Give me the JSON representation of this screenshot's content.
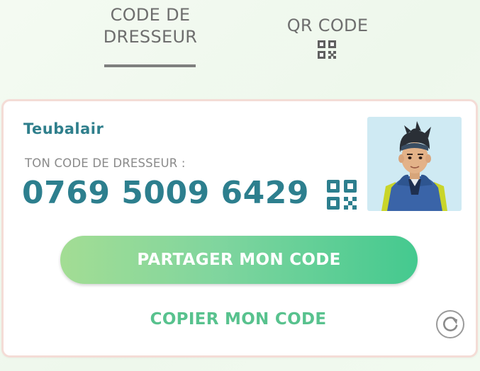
{
  "tabs": [
    {
      "label_line1": "CODE DE",
      "label_line2": "DRESSEUR",
      "active": true
    },
    {
      "label": "QR CODE",
      "icon": "qr-code-icon",
      "active": false
    }
  ],
  "card": {
    "username": "Teubalair",
    "code_label": "TON CODE DE DRESSEUR :",
    "code_value": "0769 5009 6429",
    "qr_icon": "qr-code-icon",
    "avatar_icon": "trainer-avatar",
    "share_label": "PARTAGER MON CODE",
    "copy_label": "COPIER MON CODE",
    "refresh_icon": "refresh-icon"
  },
  "colors": {
    "accent_teal": "#2d7f8e",
    "accent_green": "#58c28e",
    "button_gradient_start": "#a3dd94",
    "button_gradient_end": "#44c98f",
    "tab_text": "#6e6e6e",
    "card_border": "#f4dcd6"
  }
}
